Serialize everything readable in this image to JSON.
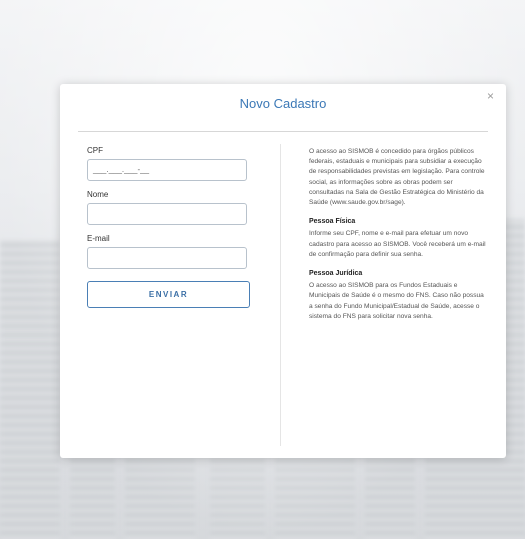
{
  "modal": {
    "title": "Novo Cadastro",
    "close": "×"
  },
  "form": {
    "cpf_label": "CPF",
    "cpf_value": "___.___.___-__",
    "nome_label": "Nome",
    "nome_value": "",
    "email_label": "E-mail",
    "email_value": "",
    "submit_label": "ENVIAR"
  },
  "info": {
    "intro": "O acesso ao SISMOB é concedido para órgãos públicos federais, estaduais e municipais para subsidiar a execução de responsabilidades previstas em legislação. Para controle social, as informações sobre as obras podem ser consultadas na Sala de Gestão Estratégica do Ministério da Saúde (www.saude.gov.br/sage).",
    "pf_title": "Pessoa Física",
    "pf_text": "Informe seu CPF, nome e e-mail para efetuar um novo cadastro para acesso ao SISMOB. Você receberá um e-mail de confirmação para definir sua senha.",
    "pj_title": "Pessoa Jurídica",
    "pj_text": "O acesso ao SISMOB para os Fundos Estaduais e Municipais de Saúde é o mesmo do FNS. Caso não possua a senha do Fundo Municipal/Estadual de Saúde, acesse o sistema do FNS para solicitar nova senha."
  }
}
